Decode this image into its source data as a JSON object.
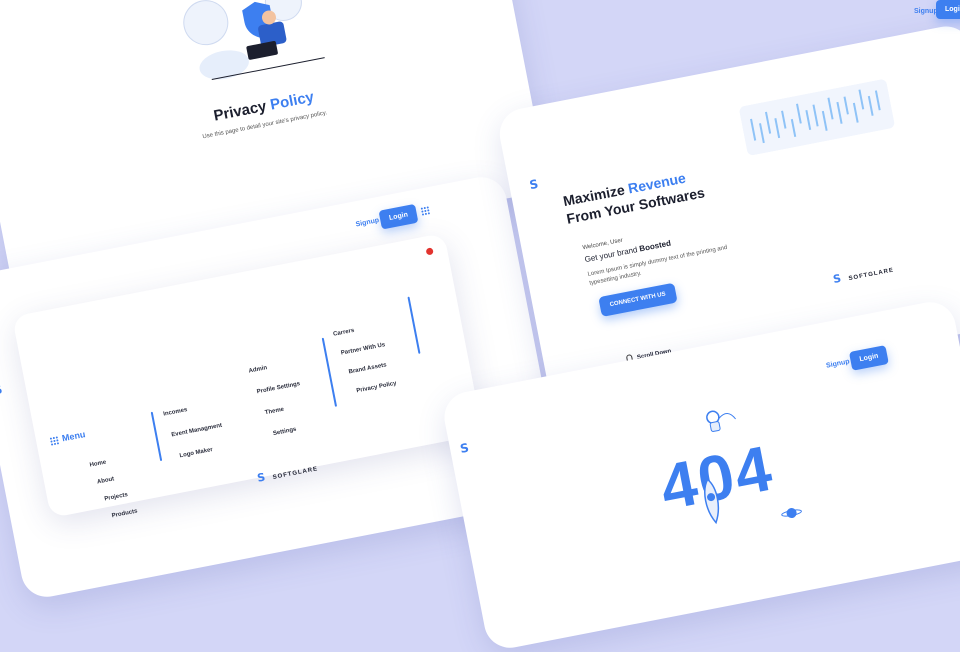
{
  "privacy": {
    "title_part1": "Privacy",
    "title_part2": "Policy",
    "subtitle": "Use this page to detail your site's privacy policy."
  },
  "menu_page": {
    "signup": "Signup",
    "login": "Login",
    "menu_title": "Menu",
    "col1": [
      "Home",
      "About",
      "Projects",
      "Products"
    ],
    "col2": [
      "Incomes",
      "Event Managment",
      "Logo Maker"
    ],
    "col3": [
      "Admin",
      "Profile Settings",
      "Theme",
      "Settings"
    ],
    "col4": [
      "Carrers",
      "Partner With Us",
      "Brand Assets",
      "Privacy Policy"
    ],
    "brand": "SOFTGLARE"
  },
  "revenue": {
    "headline_part1": "Maximize",
    "headline_part2": "Revenue",
    "headline_line2": "From Your Softwares",
    "welcome": "Welcome, User",
    "tagline_part1": "Get your brand",
    "tagline_part2": "Boosted",
    "body": "Lorem Ipsum is simply dummy text of the printing and typesetting industry.",
    "cta": "CONNECT WITH US",
    "scroll": "Scroll Down",
    "brand": "SOFTGLARE",
    "signup": "Signup",
    "login": "Login"
  },
  "notfound": {
    "code": "404",
    "signup": "Signup",
    "login": "Login"
  },
  "colors": {
    "accent": "#3d7ff0",
    "background": "#d3d6f7",
    "close_dot": "#e2332e"
  },
  "icons": [
    "shield-icon",
    "grid-icon",
    "softglare-logo-icon",
    "mouse-icon",
    "rocket-icon",
    "astronaut-icon",
    "planet-icon"
  ]
}
